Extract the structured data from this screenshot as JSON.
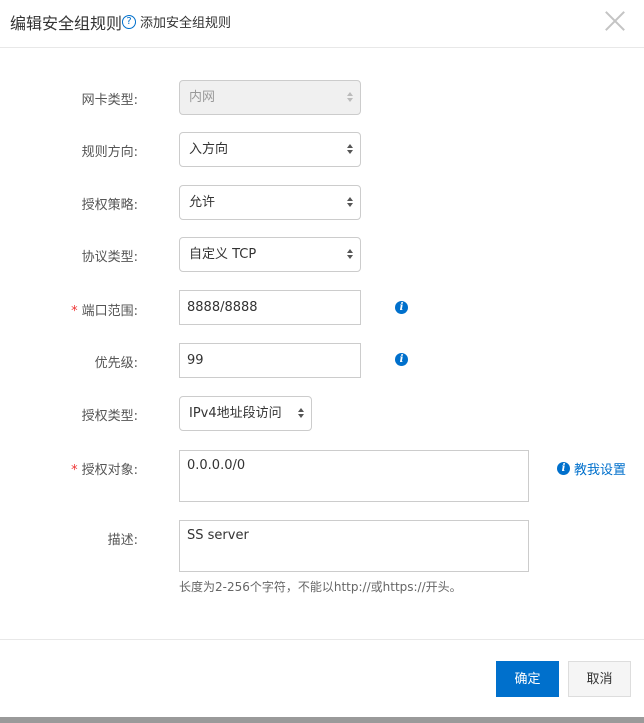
{
  "dialog": {
    "title": "编辑安全组规则",
    "help_icon": "question-circle-icon",
    "help_link": "添加安全组规则",
    "close_icon": "close-icon"
  },
  "form": {
    "nic_type": {
      "label": "网卡类型:",
      "value": "内网",
      "disabled": true
    },
    "direction": {
      "label": "规则方向:",
      "value": "入方向"
    },
    "policy": {
      "label": "授权策略:",
      "value": "允许"
    },
    "protocol": {
      "label": "协议类型:",
      "value": "自定义 TCP"
    },
    "port_range": {
      "label": "端口范围:",
      "required": "*",
      "value": "8888/8888",
      "info_icon": "info-icon"
    },
    "priority": {
      "label": "优先级:",
      "value": "99",
      "info_icon": "info-icon"
    },
    "auth_type": {
      "label": "授权类型:",
      "value": "IPv4地址段访问"
    },
    "auth_object": {
      "label": "授权对象:",
      "required": "*",
      "value": "0.0.0.0/0",
      "help_text": "教我设置",
      "info_icon": "info-icon"
    },
    "description": {
      "label": "描述:",
      "value": "SS server",
      "hint": "长度为2-256个字符，不能以http://或https://开头。"
    }
  },
  "footer": {
    "ok_label": "确定",
    "cancel_label": "取消"
  },
  "colors": {
    "primary": "#0070cc",
    "required": "#e33333"
  }
}
